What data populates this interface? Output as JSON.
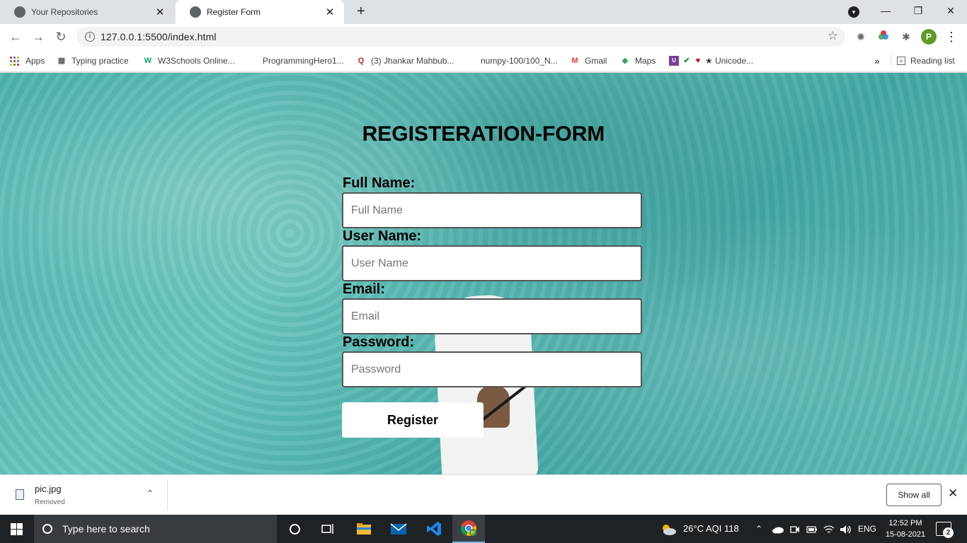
{
  "tabs": [
    {
      "title": "Your Repositories",
      "active": false
    },
    {
      "title": "Register Form",
      "active": true
    }
  ],
  "icons": {
    "new_tab": "+",
    "close": "✕",
    "minimize": "—",
    "restore": "❐",
    "back": "←",
    "forward": "→",
    "reload": "↻",
    "star": "☆",
    "extensions": "✱",
    "menu": "⋮",
    "caret_up": "⌃",
    "chevron_more": "»"
  },
  "address_bar": {
    "url": "127.0.0.1:5500/index.html"
  },
  "profile_initial": "P",
  "bookmarks": [
    {
      "label": "Apps",
      "icon": "apps-icon"
    },
    {
      "label": "Typing practice",
      "icon": "typing-icon"
    },
    {
      "label": "W3Schools Online...",
      "icon": "w3schools-icon"
    },
    {
      "label": "ProgrammingHero1...",
      "icon": "blank-icon"
    },
    {
      "label": "(3) Jhankar Mahbub...",
      "icon": "quora-icon"
    },
    {
      "label": "numpy-100/100_N...",
      "icon": "blank-icon"
    },
    {
      "label": "Gmail",
      "icon": "gmail-icon"
    },
    {
      "label": "Maps",
      "icon": "maps-icon"
    },
    {
      "label": "★ Unicode...",
      "icon": "unicode-icon"
    }
  ],
  "reading_list": "Reading list",
  "form": {
    "title": "REGISTERATION-FORM",
    "fields": [
      {
        "label": "Full Name:",
        "placeholder": "Full Name",
        "type": "text"
      },
      {
        "label": "User Name:",
        "placeholder": "User Name",
        "type": "text"
      },
      {
        "label": "Email:",
        "placeholder": "Email",
        "type": "email"
      },
      {
        "label": "Password:",
        "placeholder": "Password",
        "type": "password"
      }
    ],
    "submit_label": "Register"
  },
  "download": {
    "filename": "pic.jpg",
    "status": "Removed",
    "show_all": "Show all"
  },
  "taskbar": {
    "search_placeholder": "Type here to search",
    "weather": "26°C  AQI 118",
    "language": "ENG",
    "time": "12:52 PM",
    "date": "15-08-2021",
    "notifications": "2"
  },
  "colors": {
    "tabstrip": "#dee1e6",
    "accent_profile": "#5f9b2a",
    "taskbar": "#1f2225",
    "water": "#4fb3ad"
  }
}
